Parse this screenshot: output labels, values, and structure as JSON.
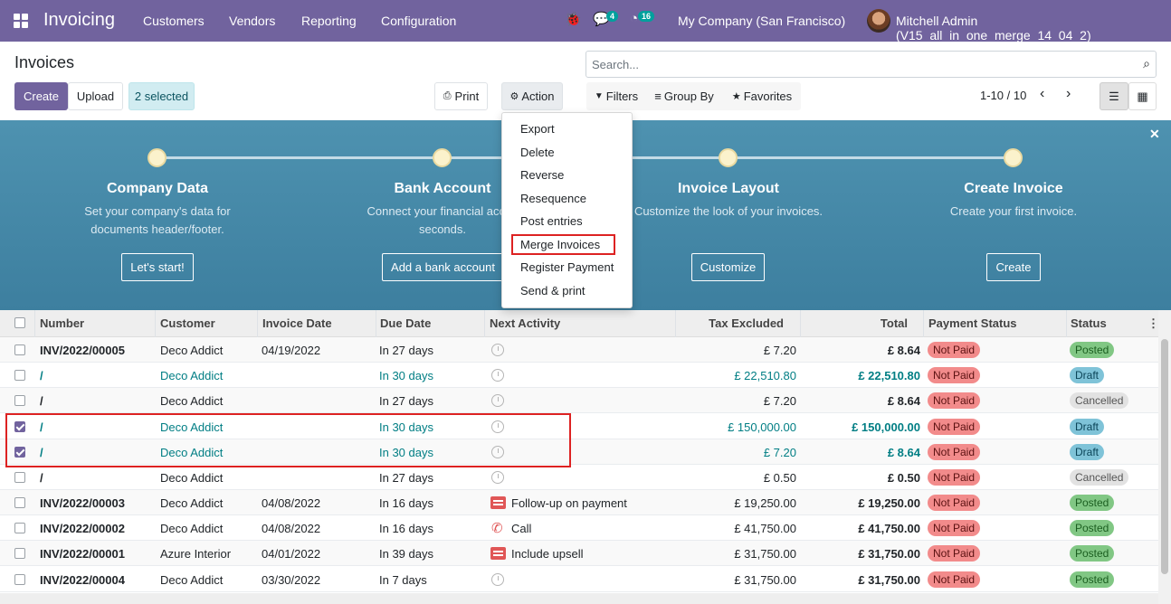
{
  "navbar": {
    "app_name": "Invoicing",
    "menu": [
      "Customers",
      "Vendors",
      "Reporting",
      "Configuration"
    ],
    "chat_count": "4",
    "activity_count": "16",
    "company": "My Company (San Francisco)",
    "user": "Mitchell Admin (V15_all_in_one_merge_14_04_2)"
  },
  "control_panel": {
    "title": "Invoices",
    "create_label": "Create",
    "upload_label": "Upload",
    "selected_label": "2 selected",
    "print_label": "Print",
    "action_label": "Action",
    "search_placeholder": "Search...",
    "filters_label": "Filters",
    "groupby_label": "Group By",
    "favorites_label": "Favorites",
    "pager": "1-10 / 10"
  },
  "action_menu": [
    "Export",
    "Delete",
    "Reverse",
    "Resequence",
    "Post entries",
    "Merge Invoices",
    "Register Payment",
    "Send & print"
  ],
  "onboarding": {
    "steps": [
      {
        "title": "Company Data",
        "desc1": "Set your company's data for",
        "desc2": "documents header/footer.",
        "button": "Let's start!"
      },
      {
        "title": "Bank Account",
        "desc1": "Connect your financial accou",
        "desc2": "seconds.",
        "button": "Add a bank account"
      },
      {
        "title": "Invoice Layout",
        "desc1": "Customize the look of your invoices.",
        "desc2": "",
        "button": "Customize"
      },
      {
        "title": "Create Invoice",
        "desc1": "Create your first invoice.",
        "desc2": "",
        "button": "Create"
      }
    ]
  },
  "table": {
    "headers": [
      "Number",
      "Customer",
      "Invoice Date",
      "Due Date",
      "Next Activity",
      "Tax Excluded",
      "Total",
      "Payment Status",
      "Status"
    ],
    "rows": [
      {
        "number": "INV/2022/00005",
        "customer": "Deco Addict",
        "date": "04/19/2022",
        "due": "In 27 days",
        "activity": "",
        "tax": "£ 7.20",
        "total": "£ 8.64",
        "payment": "Not Paid",
        "status": "Posted"
      },
      {
        "number": "/",
        "customer": "Deco Addict",
        "date": "",
        "due": "In 30 days",
        "activity": "",
        "tax": "£ 22,510.80",
        "total": "£ 22,510.80",
        "payment": "Not Paid",
        "status": "Draft"
      },
      {
        "number": "/",
        "customer": "Deco Addict",
        "date": "",
        "due": "In 27 days",
        "activity": "",
        "tax": "£ 7.20",
        "total": "£ 8.64",
        "payment": "Not Paid",
        "status": "Cancelled"
      },
      {
        "number": "/",
        "customer": "Deco Addict",
        "date": "",
        "due": "In 30 days",
        "activity": "",
        "tax": "£ 150,000.00",
        "total": "£ 150,000.00",
        "payment": "Not Paid",
        "status": "Draft"
      },
      {
        "number": "/",
        "customer": "Deco Addict",
        "date": "",
        "due": "In 30 days",
        "activity": "",
        "tax": "£ 7.20",
        "total": "£ 8.64",
        "payment": "Not Paid",
        "status": "Draft"
      },
      {
        "number": "/",
        "customer": "Deco Addict",
        "date": "",
        "due": "In 27 days",
        "activity": "",
        "tax": "£ 0.50",
        "total": "£ 0.50",
        "payment": "Not Paid",
        "status": "Cancelled"
      },
      {
        "number": "INV/2022/00003",
        "customer": "Deco Addict",
        "date": "04/08/2022",
        "due": "In 16 days",
        "activity": "Follow-up on payment",
        "tax": "£ 19,250.00",
        "total": "£ 19,250.00",
        "payment": "Not Paid",
        "status": "Posted"
      },
      {
        "number": "INV/2022/00002",
        "customer": "Deco Addict",
        "date": "04/08/2022",
        "due": "In 16 days",
        "activity": "Call",
        "tax": "£ 41,750.00",
        "total": "£ 41,750.00",
        "payment": "Not Paid",
        "status": "Posted"
      },
      {
        "number": "INV/2022/00001",
        "customer": "Azure Interior",
        "date": "04/01/2022",
        "due": "In 39 days",
        "activity": "Include upsell",
        "tax": "£ 31,750.00",
        "total": "£ 31,750.00",
        "payment": "Not Paid",
        "status": "Posted"
      },
      {
        "number": "INV/2022/00004",
        "customer": "Deco Addict",
        "date": "03/30/2022",
        "due": "In 7 days",
        "activity": "",
        "tax": "£ 31,750.00",
        "total": "£ 31,750.00",
        "payment": "Not Paid",
        "status": "Posted"
      }
    ]
  }
}
